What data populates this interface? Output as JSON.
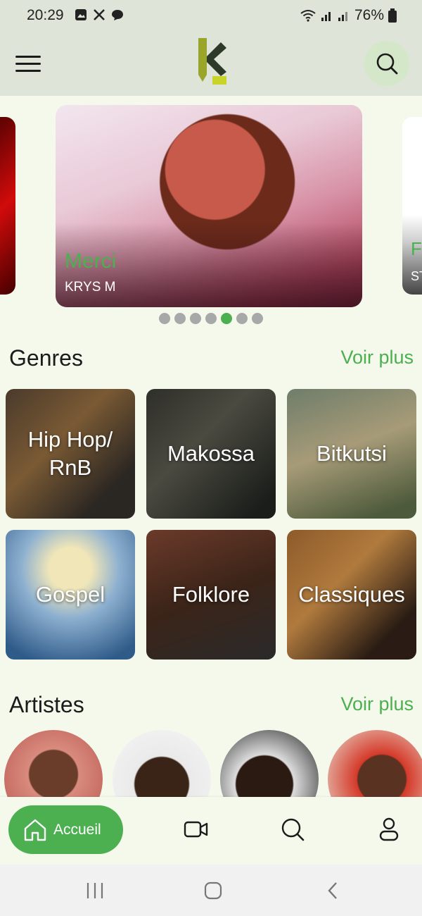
{
  "status_bar": {
    "time": "20:29",
    "battery": "76%",
    "icons": [
      "gallery-icon",
      "x-icon",
      "chat-icon",
      "wifi-icon",
      "signal-icon",
      "signal-icon",
      "battery-icon"
    ]
  },
  "header": {
    "menu_icon": "hamburger-menu-icon",
    "logo": "k-logo",
    "search_icon": "search-icon"
  },
  "carousel": {
    "slides": [
      {
        "title": "Merci",
        "artist": "KRYS M"
      }
    ],
    "peek_right": {
      "title": "F",
      "artist": "ST"
    },
    "dot_count": 7,
    "active_index": 4
  },
  "genres": {
    "title": "Genres",
    "more": "Voir plus",
    "items": [
      {
        "label": "Hip Hop/ RnB"
      },
      {
        "label": "Makossa"
      },
      {
        "label": "Bitkutsi"
      },
      {
        "label": "Gospel"
      },
      {
        "label": "Folklore"
      },
      {
        "label": "Classiques"
      }
    ]
  },
  "artists": {
    "title": "Artistes",
    "more": "Voir plus"
  },
  "bottom_nav": {
    "home_label": "Accueil",
    "home_icon": "home-icon",
    "items": [
      "video-icon",
      "search-icon",
      "profile-icon"
    ]
  },
  "colors": {
    "accent": "#4caf50",
    "background": "#f4f9ec",
    "header_bg": "#dfe4d8"
  }
}
